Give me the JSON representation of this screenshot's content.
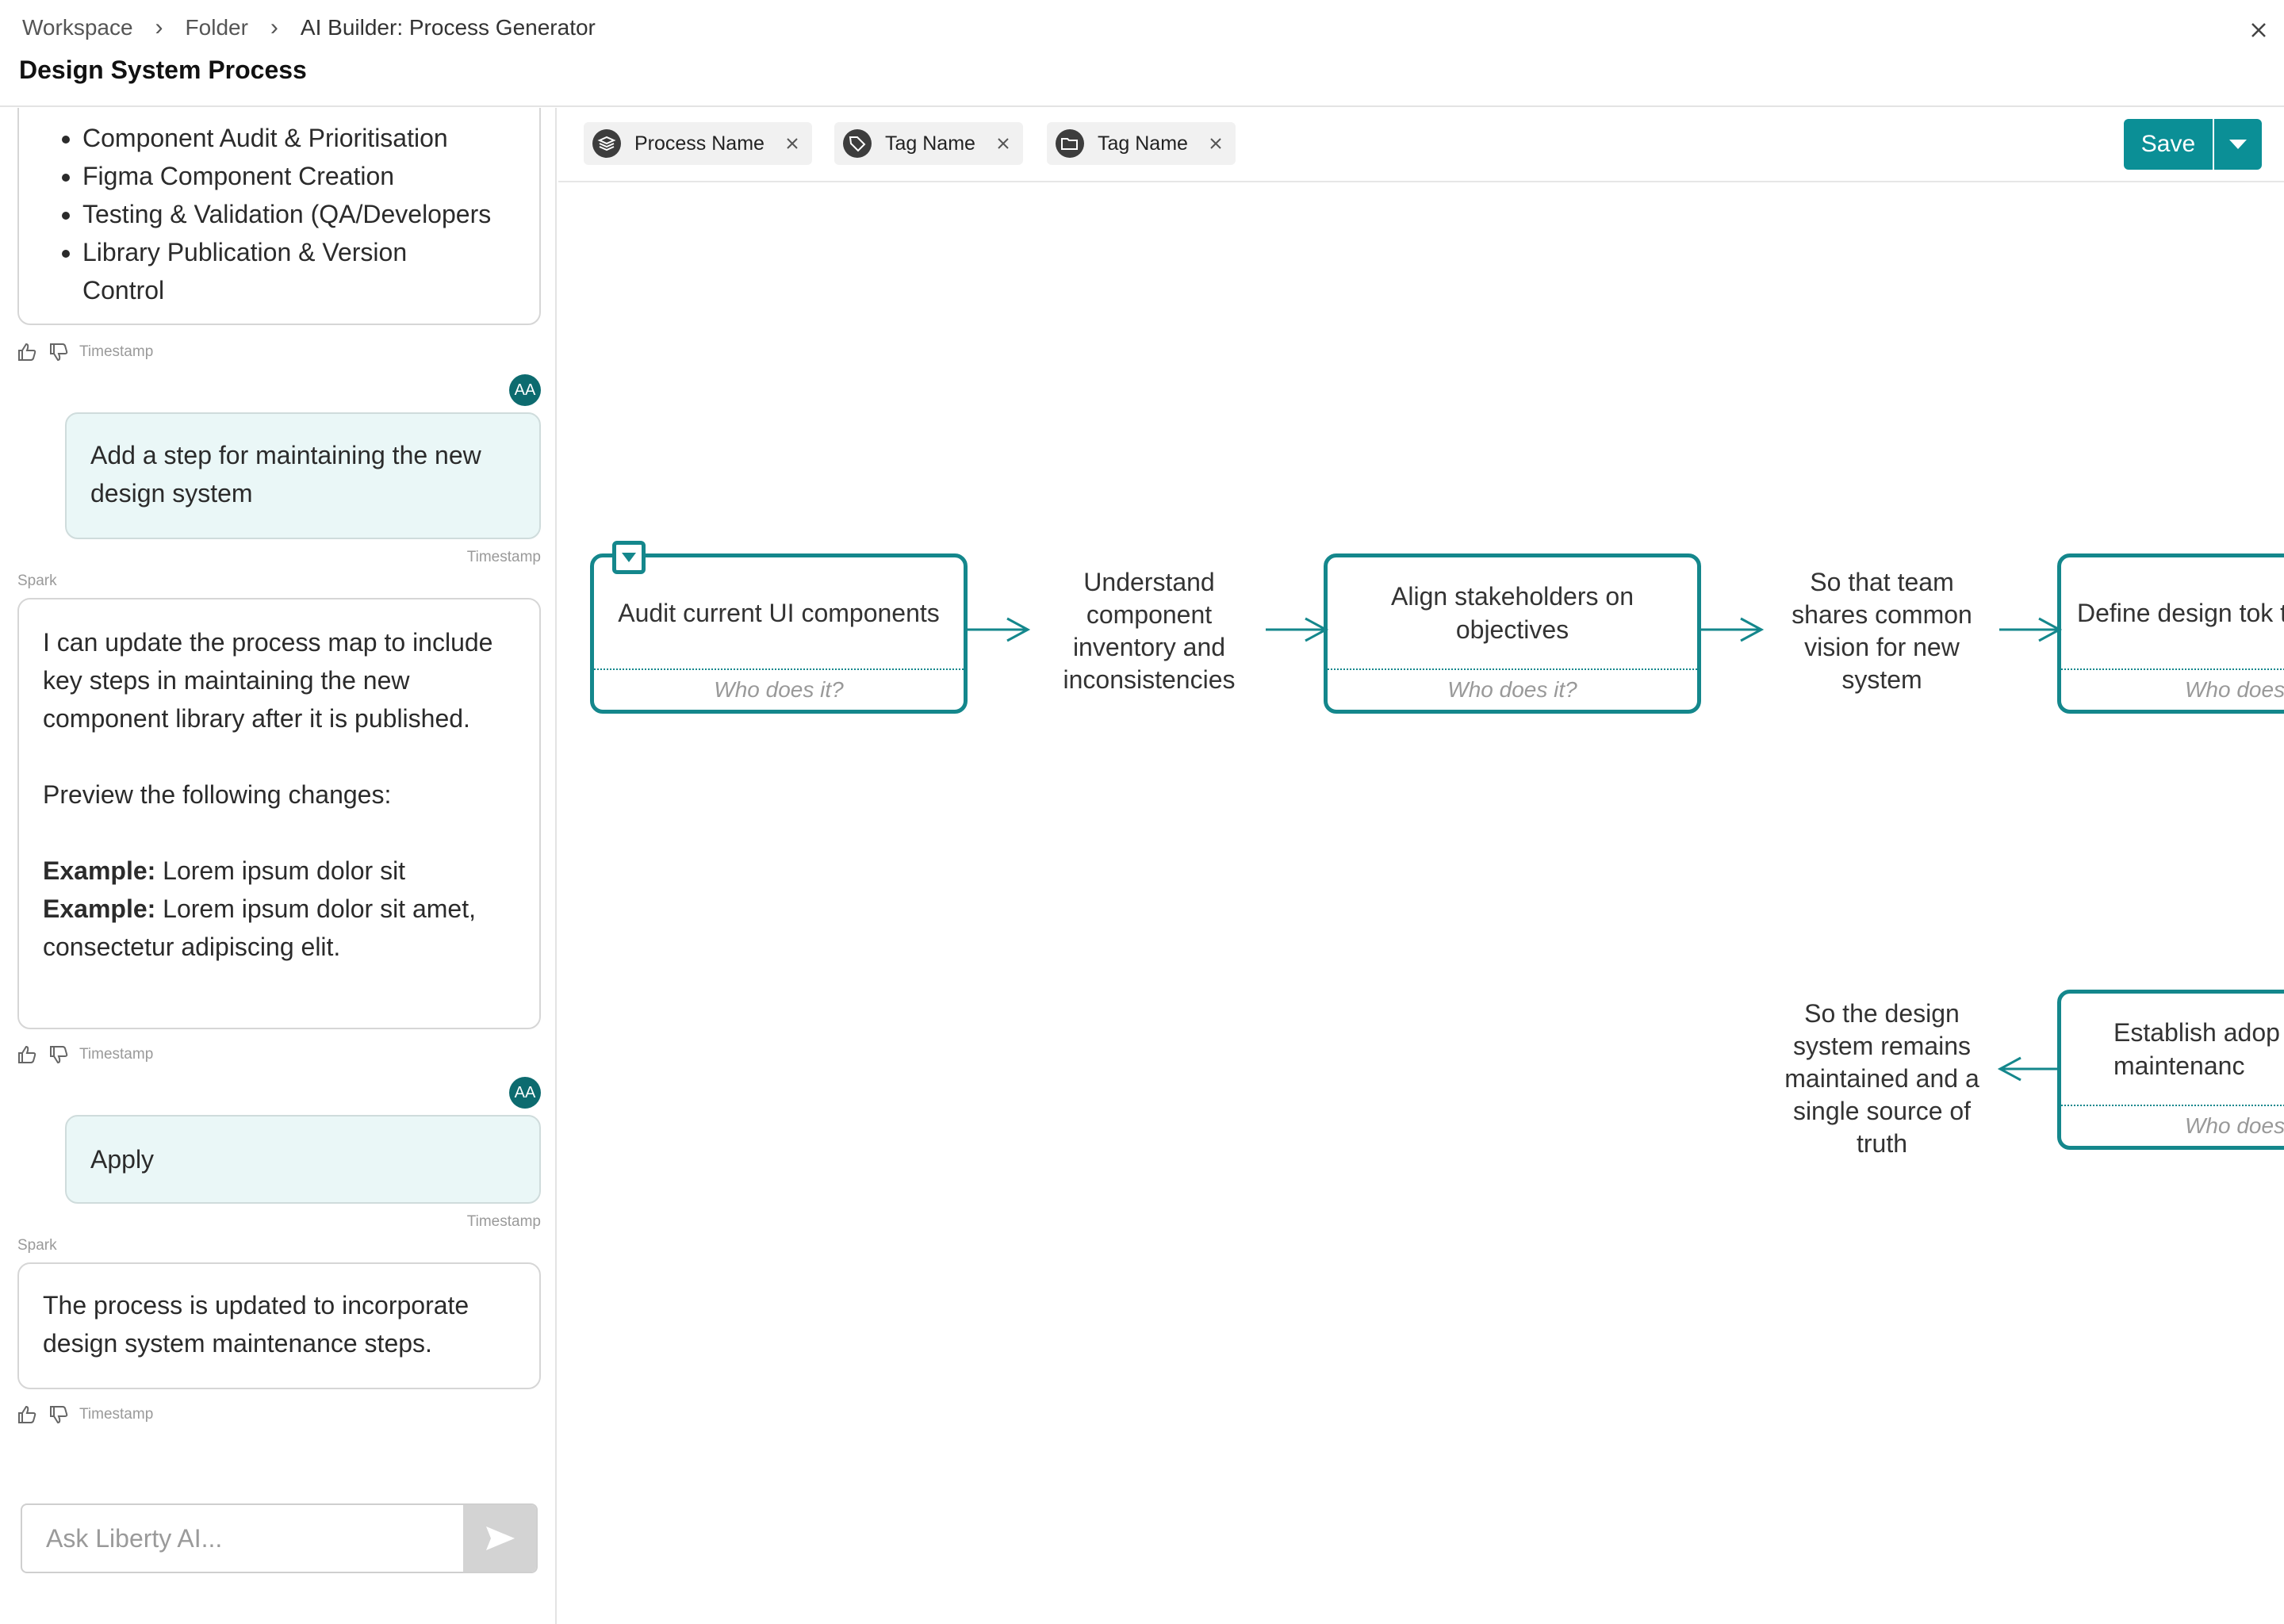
{
  "breadcrumb": [
    "Workspace",
    "Folder",
    "AI Builder: Process Generator"
  ],
  "page_title": "Design System Process",
  "chat": {
    "first_message_list": [
      "Component Audit & Prioritisation",
      "Figma Component Creation",
      "Testing & Validation (QA/Developers",
      "Library Publication & Version Control"
    ],
    "timestamp": "Timestamp",
    "avatar_initials": "AA",
    "sender_name": "Spark",
    "user_message_1": "Add a step for maintaining the new design system",
    "ai_message_1": {
      "intro": "I can update the process map to include key steps in maintaining the new component library after it is published.",
      "preview": "Preview the following changes:",
      "example_label": "Example:",
      "example_1": " Lorem ipsum dolor sit",
      "example_2": " Lorem ipsum dolor sit amet, consectetur adipiscing elit."
    },
    "user_message_2": "Apply",
    "ai_message_2": "The process is updated to incorporate design system maintenance steps.",
    "ask_placeholder": "Ask Liberty AI..."
  },
  "toolbar": {
    "chips": [
      {
        "label": "Process Name",
        "icon": "layers-icon"
      },
      {
        "label": "Tag Name",
        "icon": "tag-icon"
      },
      {
        "label": "Tag Name",
        "icon": "folder-icon"
      }
    ],
    "save_label": "Save"
  },
  "process": {
    "steps": [
      {
        "title": "Audit current UI components",
        "who": "Who does it?"
      },
      {
        "title": "Align stakeholders on objectives",
        "who": "Who does it?"
      },
      {
        "title": "Define design tok typography",
        "who": "Who does"
      },
      {
        "title": "Establish adop maintenanc",
        "who": "Who does"
      }
    ],
    "outcomes": [
      "Understand component inventory and inconsistencies",
      "So that team shares common vision for new system",
      "So the design system remains maintained and a single source of truth"
    ]
  },
  "colors": {
    "accent": "#0b8f96",
    "node_border": "#14878c",
    "avatar": "#0d6b6f",
    "user_bubble": "#eaf7f7"
  }
}
